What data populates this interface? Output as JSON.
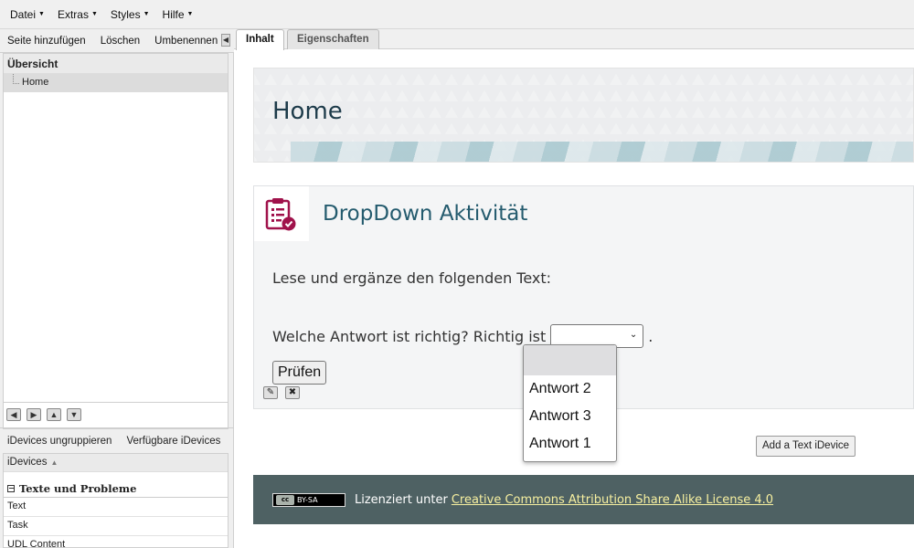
{
  "menu": [
    {
      "label": "Datei"
    },
    {
      "label": "Extras"
    },
    {
      "label": "Styles"
    },
    {
      "label": "Hilfe"
    }
  ],
  "left_toolbar": {
    "add_page": "Seite hinzufügen",
    "delete": "Löschen",
    "rename": "Umbenennen"
  },
  "overview": {
    "title": "Übersicht",
    "items": [
      "Home"
    ]
  },
  "idevice_toolbar": {
    "ungroup": "iDevices ungruppieren",
    "available": "Verfügbare iDevices"
  },
  "idevice_list": {
    "header": "iDevices",
    "category": "Texte und Probleme",
    "items": [
      "Text",
      "Task",
      "UDL Content"
    ]
  },
  "tabs": {
    "content": "Inhalt",
    "properties": "Eigenschaften"
  },
  "page": {
    "title": "Home"
  },
  "idevice": {
    "title": "DropDown Aktivität",
    "instruction": "Lese und ergänze den folgenden Text:",
    "question": "Welche Antwort ist richtig? Richtig ist",
    "period": ".",
    "check_button": "Prüfen"
  },
  "dropdown": {
    "options": [
      "",
      "Antwort 2",
      "Antwort 3",
      "Antwort 1"
    ]
  },
  "add_text_idevice": "Add a Text iDevice",
  "footer": {
    "badge_cc": "cc",
    "badge_text": "BY-SA",
    "license_prefix": "Lizenziert unter",
    "license_link": "Creative Commons Attribution Share Alike License 4.0"
  },
  "colors": {
    "footer_bg": "#4e6163",
    "title_color": "#245b6e",
    "icon_color": "#a0124b",
    "link_color": "#f7f0a0"
  }
}
